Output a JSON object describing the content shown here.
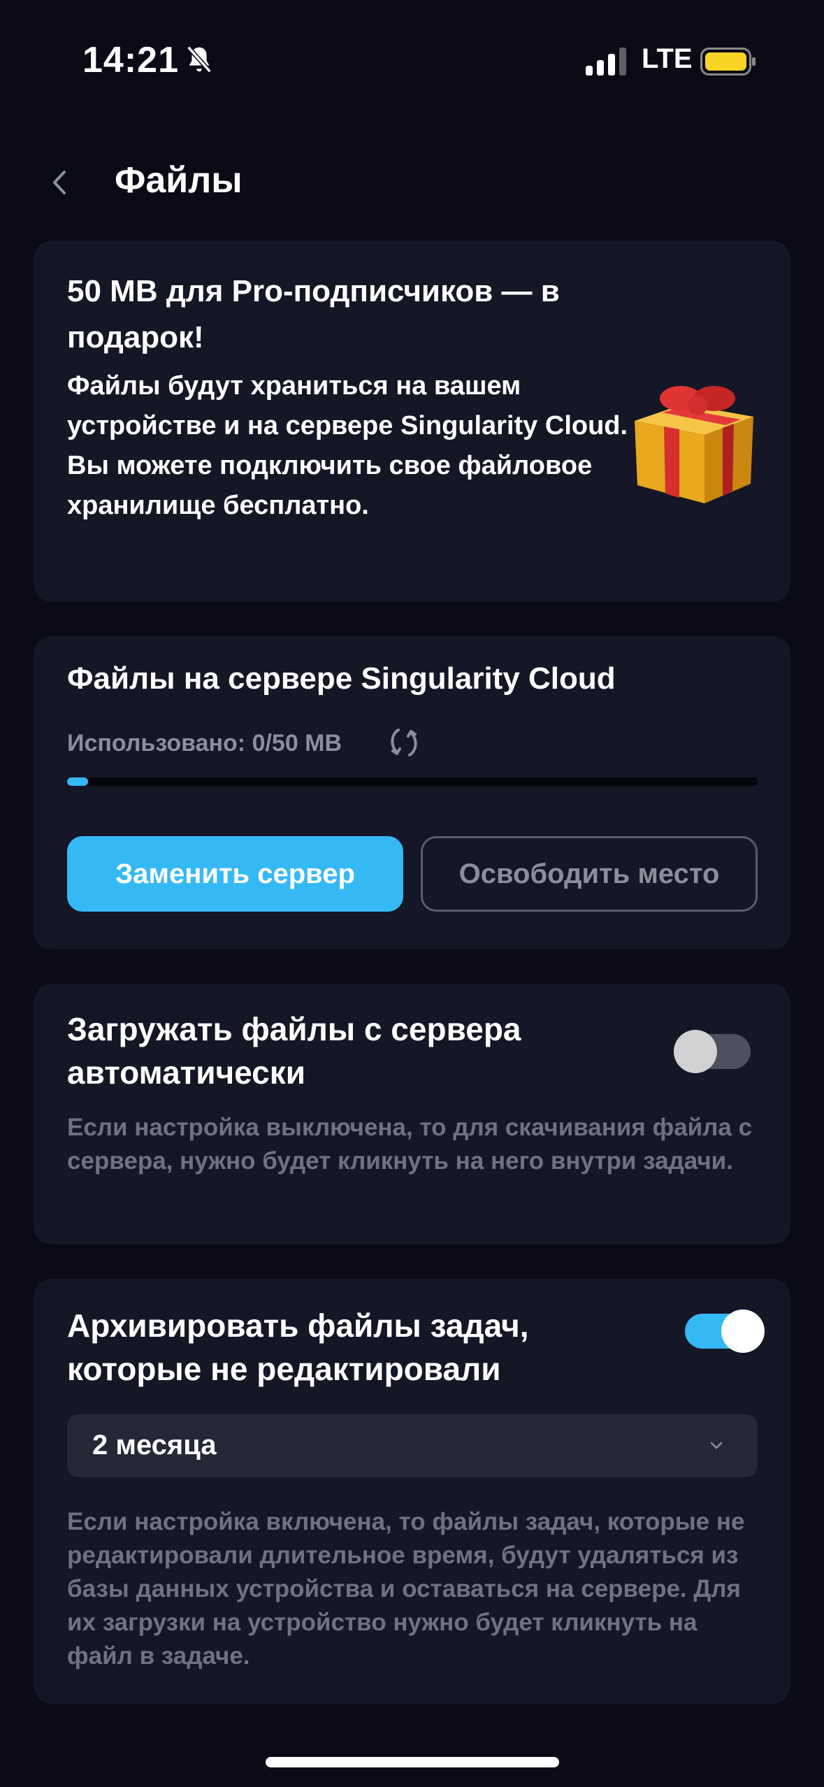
{
  "status": {
    "time": "14:21",
    "network": "LTE",
    "icons": [
      "bell-muted-icon",
      "signal-icon",
      "battery-icon"
    ],
    "battery_color": "#f7d325"
  },
  "header": {
    "title": "Файлы",
    "back_icon": "chevron-left-icon"
  },
  "promo": {
    "heading": "50 MB для Pro-подписчиков — в подарок!",
    "body_line1": "Файлы будут храниться на вашем устройстве и на сервере Singularity Cloud.",
    "body_line2": "Вы можете подключить свое файловое хранилище бесплатно.",
    "icon": "gift-icon"
  },
  "storage": {
    "heading": "Файлы на сервере Singularity Cloud",
    "usage_label": "Использовано: 0/50 MB",
    "usage_fraction": 0.03,
    "refresh_icon": "sync-icon",
    "replace_button": "Заменить сервер",
    "free_button": "Освободить место"
  },
  "auto_download": {
    "heading": "Загружать файлы с сервера автоматически",
    "enabled": false,
    "description": "Если настройка выключена, то для скачивания файла с сервера, нужно будет кликнуть на него внутри задачи."
  },
  "archive": {
    "heading": "Архивировать файлы задач, которые не редактировали",
    "enabled": true,
    "period_value": "2 месяца",
    "description": "Если настройка включена, то файлы задач, которые не редактировали длительное время, будут удаляться из базы данных устройства и оставаться на сервере. Для их загрузки на устройство нужно будет кликнуть на файл в задаче."
  },
  "colors": {
    "accent": "#35b9f5",
    "background": "#0b0a17",
    "card": "#151626"
  }
}
